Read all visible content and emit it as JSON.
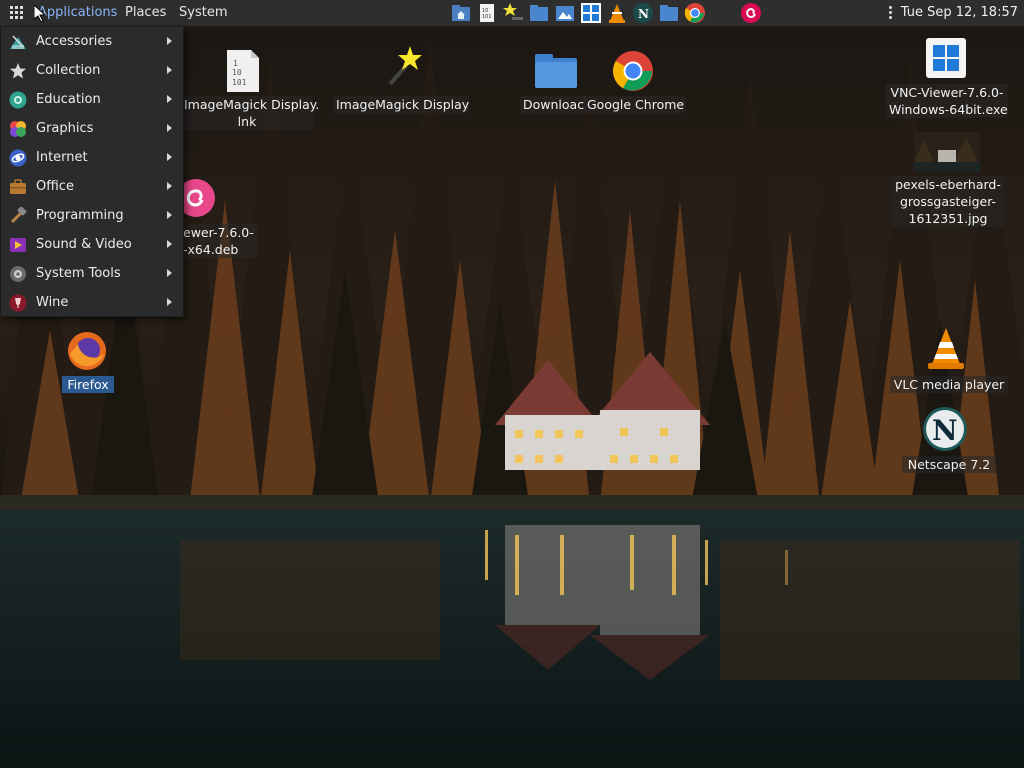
{
  "panel": {
    "menus": [
      "Applications",
      "Places",
      "System"
    ],
    "clock": "Tue Sep 12, 18:57",
    "launchers": [
      "home-folder-icon",
      "text-file-icon",
      "imagemagick-icon",
      "folder-icon",
      "image-viewer-icon",
      "windows-icon",
      "vlc-icon",
      "netscape-icon",
      "folder-icon",
      "chrome-icon",
      "debian-icon"
    ]
  },
  "apps_menu": {
    "items": [
      {
        "label": "Accessories",
        "icon": "accessories-icon"
      },
      {
        "label": "Collection",
        "icon": "star-icon"
      },
      {
        "label": "Education",
        "icon": "education-icon"
      },
      {
        "label": "Graphics",
        "icon": "graphics-icon"
      },
      {
        "label": "Internet",
        "icon": "internet-icon"
      },
      {
        "label": "Office",
        "icon": "office-icon"
      },
      {
        "label": "Programming",
        "icon": "programming-icon"
      },
      {
        "label": "Sound & Video",
        "icon": "sound-video-icon"
      },
      {
        "label": "System Tools",
        "icon": "system-tools-icon"
      },
      {
        "label": "Wine",
        "icon": "wine-icon"
      }
    ]
  },
  "desktop": {
    "imagemagick_lnk": {
      "line1": "ImageMagick Display.",
      "line2": "lnk"
    },
    "imagemagick": {
      "label": "ImageMagick Display"
    },
    "downloads": {
      "label": "Downloac"
    },
    "chrome": {
      "label": "Google Chrome"
    },
    "vnc_exe": {
      "line1": "VNC-Viewer-7.6.0-",
      "line2": "Windows-64bit.exe"
    },
    "vnc_deb": {
      "line1": "ewer-7.6.0-",
      "line2": "-x64.deb"
    },
    "jpg": {
      "line1": "pexels-eberhard-",
      "line2": "grossgasteiger-",
      "line3": "1612351.jpg"
    },
    "firefox": {
      "label": "Firefox"
    },
    "vlc": {
      "label": "VLC media player"
    },
    "netscape": {
      "label": "Netscape 7.2"
    }
  }
}
